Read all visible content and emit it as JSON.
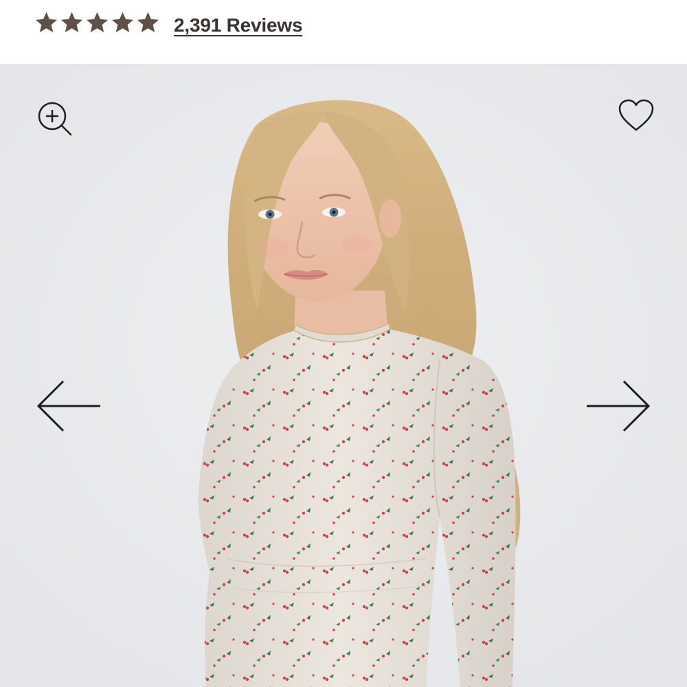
{
  "rating": {
    "stars": 5,
    "star_color": "#5f5148",
    "reviews_label": "2,391 Reviews"
  },
  "gallery": {
    "background_color": "#e8e9eb",
    "image": {
      "subject": "model-in-holly-print-long-sleeve-top",
      "print_colors": [
        "#c7343a",
        "#2f6b3a"
      ],
      "fabric_color": "#e7e0d8"
    },
    "icons": {
      "zoom": "zoom-in-icon",
      "favorite": "heart-outline-icon",
      "previous": "arrow-left-icon",
      "next": "arrow-right-icon"
    }
  }
}
